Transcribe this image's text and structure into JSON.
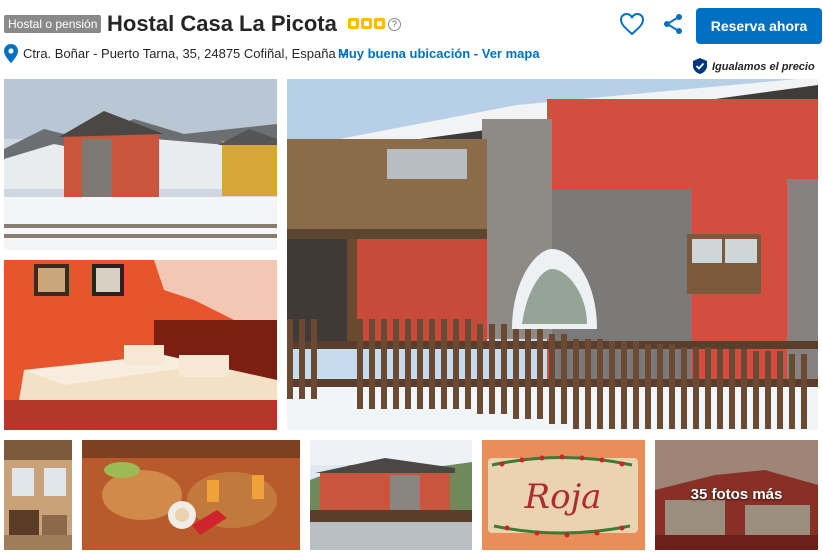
{
  "header": {
    "property_type": "Hostal o pensión",
    "title": "Hostal Casa La Picota",
    "star_rating": 3,
    "info_icon": "info-icon",
    "favorite_icon": "heart-icon",
    "share_icon": "share-icon",
    "reserve_label": "Reserva ahora"
  },
  "address": {
    "icon": "location-pin-icon",
    "text": "Ctra. Boñar - Puerto Tarna, 35, 24875 Cofiñal, España –",
    "link_text": "Muy buena ubicación - Ver mapa"
  },
  "price_match": {
    "icon": "price-match-badge-icon",
    "text": "Igualamos el precio"
  },
  "gallery": {
    "more_photos_label": "35 fotos más",
    "sign_text": "Roja"
  },
  "colors": {
    "primary_blue": "#0071c2",
    "star_yellow": "#febb02",
    "badge_gray": "#8a8a8a",
    "text_dark": "#262626"
  }
}
